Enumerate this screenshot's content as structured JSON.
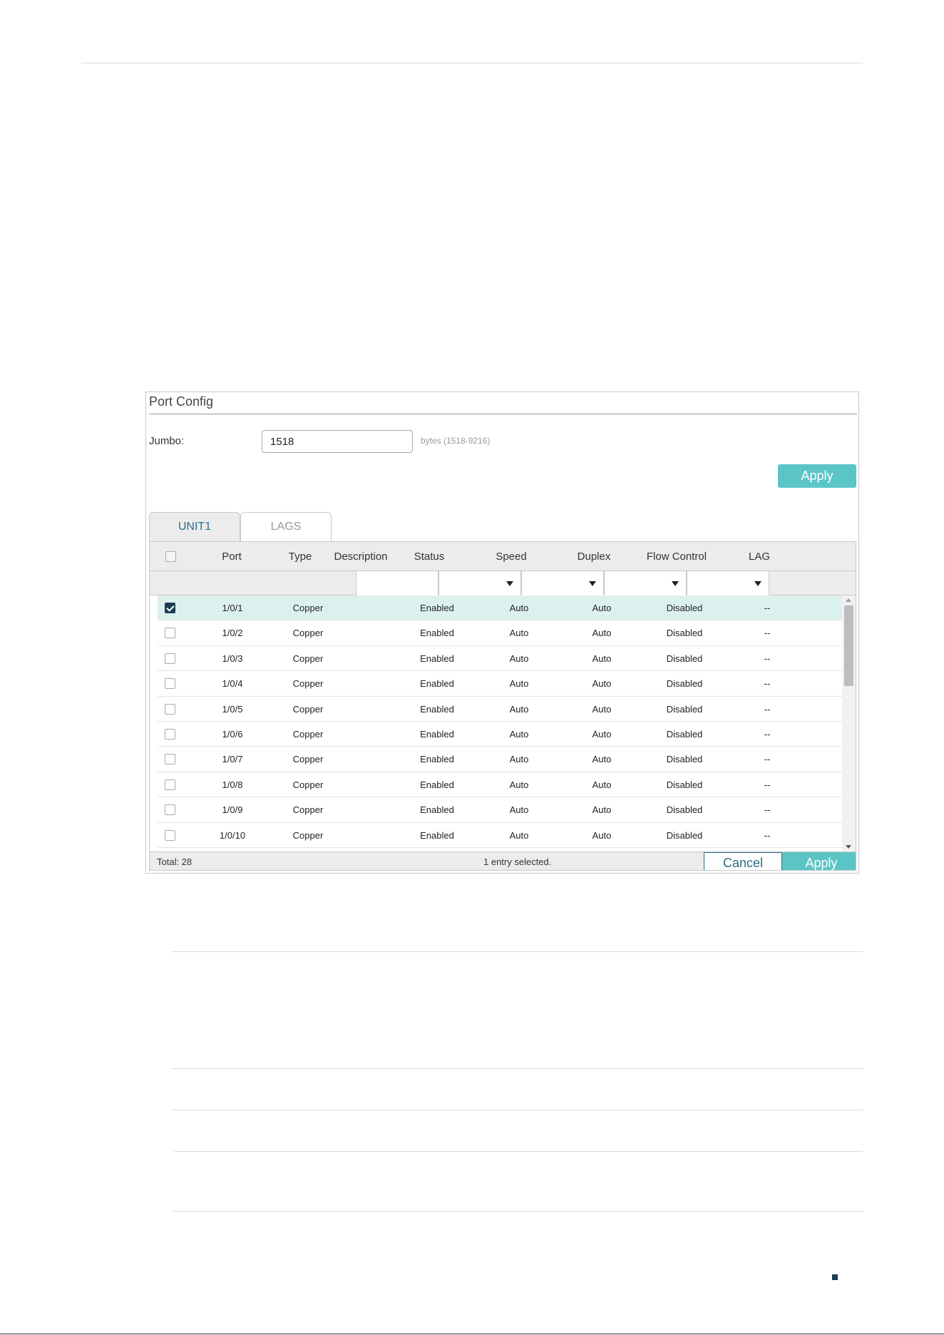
{
  "panel": {
    "title": "Port Config",
    "jumbo_label": "Jumbo:",
    "jumbo_value": "1518",
    "jumbo_hint": "bytes (1518-9216)",
    "apply_label": "Apply"
  },
  "tabs": [
    {
      "label": "UNIT1",
      "active": true
    },
    {
      "label": "LAGS",
      "active": false
    }
  ],
  "table": {
    "columns": [
      "Port",
      "Type",
      "Description",
      "Status",
      "Speed",
      "Duplex",
      "Flow Control",
      "LAG"
    ],
    "rows": [
      {
        "checked": true,
        "port": "1/0/1",
        "type": "Copper",
        "description": "",
        "status": "Enabled",
        "speed": "Auto",
        "duplex": "Auto",
        "flow_control": "Disabled",
        "lag": "--"
      },
      {
        "checked": false,
        "port": "1/0/2",
        "type": "Copper",
        "description": "",
        "status": "Enabled",
        "speed": "Auto",
        "duplex": "Auto",
        "flow_control": "Disabled",
        "lag": "--"
      },
      {
        "checked": false,
        "port": "1/0/3",
        "type": "Copper",
        "description": "",
        "status": "Enabled",
        "speed": "Auto",
        "duplex": "Auto",
        "flow_control": "Disabled",
        "lag": "--"
      },
      {
        "checked": false,
        "port": "1/0/4",
        "type": "Copper",
        "description": "",
        "status": "Enabled",
        "speed": "Auto",
        "duplex": "Auto",
        "flow_control": "Disabled",
        "lag": "--"
      },
      {
        "checked": false,
        "port": "1/0/5",
        "type": "Copper",
        "description": "",
        "status": "Enabled",
        "speed": "Auto",
        "duplex": "Auto",
        "flow_control": "Disabled",
        "lag": "--"
      },
      {
        "checked": false,
        "port": "1/0/6",
        "type": "Copper",
        "description": "",
        "status": "Enabled",
        "speed": "Auto",
        "duplex": "Auto",
        "flow_control": "Disabled",
        "lag": "--"
      },
      {
        "checked": false,
        "port": "1/0/7",
        "type": "Copper",
        "description": "",
        "status": "Enabled",
        "speed": "Auto",
        "duplex": "Auto",
        "flow_control": "Disabled",
        "lag": "--"
      },
      {
        "checked": false,
        "port": "1/0/8",
        "type": "Copper",
        "description": "",
        "status": "Enabled",
        "speed": "Auto",
        "duplex": "Auto",
        "flow_control": "Disabled",
        "lag": "--"
      },
      {
        "checked": false,
        "port": "1/0/9",
        "type": "Copper",
        "description": "",
        "status": "Enabled",
        "speed": "Auto",
        "duplex": "Auto",
        "flow_control": "Disabled",
        "lag": "--"
      },
      {
        "checked": false,
        "port": "1/0/10",
        "type": "Copper",
        "description": "",
        "status": "Enabled",
        "speed": "Auto",
        "duplex": "Auto",
        "flow_control": "Disabled",
        "lag": "--"
      }
    ],
    "total": "Total: 28",
    "selection_info": "1 entry selected.",
    "cancel_label": "Cancel",
    "apply_label": "Apply"
  },
  "colors": {
    "accent": "#5bc5c6",
    "selected_row": "#dcf1ee",
    "dark_navy": "#1c3e50",
    "tab_text": "#2c6f86"
  },
  "icons": {
    "dropdown": "caret-down-icon",
    "checkbox_checked": "check-icon"
  }
}
